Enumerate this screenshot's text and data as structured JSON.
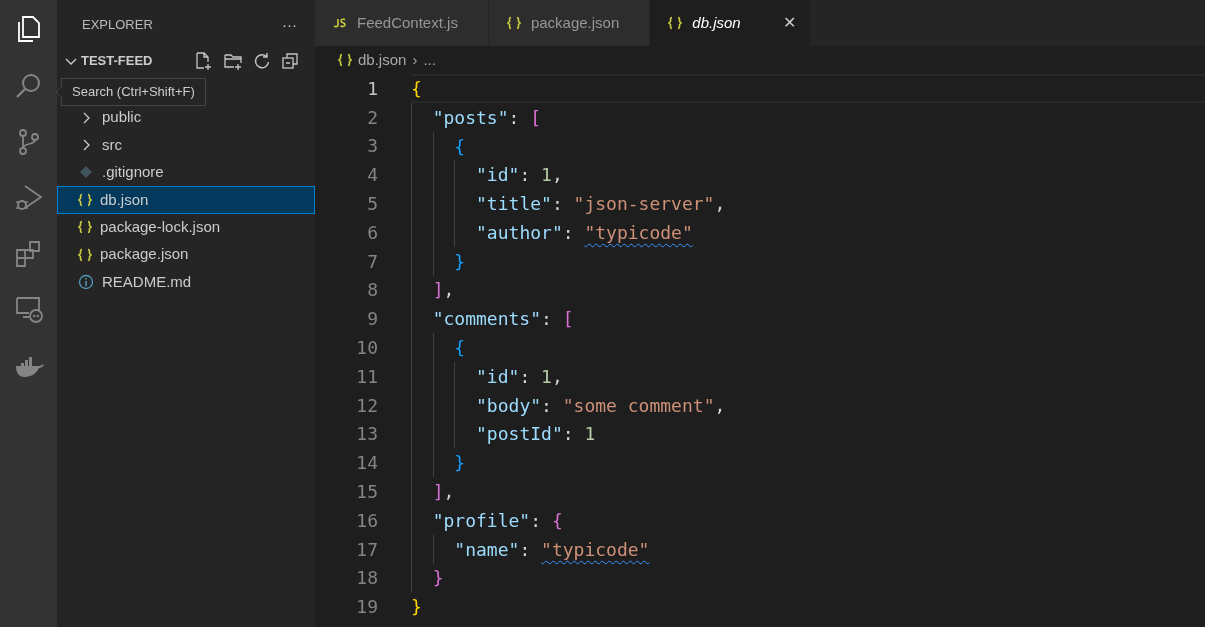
{
  "activity_bar": [
    {
      "kind": "files",
      "selected": true
    },
    {
      "kind": "search",
      "selected": false
    },
    {
      "kind": "git",
      "selected": false
    },
    {
      "kind": "debug",
      "selected": false
    },
    {
      "kind": "extensions",
      "selected": false
    },
    {
      "kind": "remote",
      "selected": false
    },
    {
      "kind": "docker",
      "selected": false
    }
  ],
  "tooltip": "Search (Ctrl+Shift+F)",
  "sidebar": {
    "title": "EXPLORER",
    "more": "···",
    "folder": {
      "name": "TEST-FEED",
      "expanded": true
    },
    "items": [
      {
        "kind": "folder",
        "name": "public",
        "expanded": false,
        "selected": false
      },
      {
        "kind": "folder",
        "name": "src",
        "expanded": false,
        "selected": false
      },
      {
        "kind": "git",
        "name": ".gitignore",
        "selected": false
      },
      {
        "kind": "json",
        "name": "db.json",
        "selected": true
      },
      {
        "kind": "json",
        "name": "package-lock.json",
        "selected": false
      },
      {
        "kind": "json",
        "name": "package.json",
        "selected": false
      },
      {
        "kind": "info",
        "name": "README.md",
        "selected": false
      }
    ]
  },
  "tabs": [
    {
      "kind": "js",
      "label": "FeedContext.js",
      "selected": false
    },
    {
      "kind": "json",
      "label": "package.json",
      "selected": false
    },
    {
      "kind": "json",
      "label": "db.json",
      "selected": true,
      "close": "✕"
    }
  ],
  "breadcrumb": {
    "file": "db.json",
    "sep": "›",
    "rest": "..."
  },
  "lines": [
    {
      "number": "1",
      "current": true,
      "tokens": [
        {
          "kind": "open1",
          "text": "{"
        }
      ]
    },
    {
      "number": "2",
      "tokens": [
        {
          "kind": "key",
          "text": "\"posts\""
        },
        {
          "kind": "punct",
          "text": ": "
        },
        {
          "kind": "open2",
          "text": "["
        }
      ]
    },
    {
      "number": "3",
      "tokens": [
        {
          "kind": "open3",
          "text": "{"
        }
      ]
    },
    {
      "number": "4",
      "tokens": [
        {
          "kind": "key",
          "text": "\"id\""
        },
        {
          "kind": "punct",
          "text": ": "
        },
        {
          "kind": "number",
          "text": "1"
        },
        {
          "kind": "punct",
          "text": ","
        }
      ]
    },
    {
      "number": "5",
      "tokens": [
        {
          "kind": "key",
          "text": "\"title\""
        },
        {
          "kind": "punct",
          "text": ": "
        },
        {
          "kind": "string",
          "text": "\"json-server\""
        },
        {
          "kind": "punct",
          "text": ","
        }
      ]
    },
    {
      "number": "6",
      "tokens": [
        {
          "kind": "key",
          "text": "\"author\""
        },
        {
          "kind": "punct",
          "text": ": "
        },
        {
          "kind": "string",
          "text": "\"typicode\"",
          "squiggle": true
        }
      ]
    },
    {
      "number": "7",
      "tokens": [
        {
          "kind": "close3",
          "text": "}"
        }
      ]
    },
    {
      "number": "8",
      "tokens": [
        {
          "kind": "close2",
          "text": "]"
        },
        {
          "kind": "punct",
          "text": ","
        }
      ]
    },
    {
      "number": "9",
      "tokens": [
        {
          "kind": "key",
          "text": "\"comments\""
        },
        {
          "kind": "punct",
          "text": ": "
        },
        {
          "kind": "open2",
          "text": "["
        }
      ]
    },
    {
      "number": "10",
      "tokens": [
        {
          "kind": "open3",
          "text": "{"
        }
      ]
    },
    {
      "number": "11",
      "tokens": [
        {
          "kind": "key",
          "text": "\"id\""
        },
        {
          "kind": "punct",
          "text": ": "
        },
        {
          "kind": "number",
          "text": "1"
        },
        {
          "kind": "punct",
          "text": ","
        }
      ]
    },
    {
      "number": "12",
      "tokens": [
        {
          "kind": "key",
          "text": "\"body\""
        },
        {
          "kind": "punct",
          "text": ": "
        },
        {
          "kind": "string",
          "text": "\"some comment\""
        },
        {
          "kind": "punct",
          "text": ","
        }
      ]
    },
    {
      "number": "13",
      "tokens": [
        {
          "kind": "key",
          "text": "\"postId\""
        },
        {
          "kind": "punct",
          "text": ": "
        },
        {
          "kind": "number",
          "text": "1"
        }
      ]
    },
    {
      "number": "14",
      "tokens": [
        {
          "kind": "close3",
          "text": "}"
        }
      ]
    },
    {
      "number": "15",
      "tokens": [
        {
          "kind": "close2",
          "text": "]"
        },
        {
          "kind": "punct",
          "text": ","
        }
      ]
    },
    {
      "number": "16",
      "tokens": [
        {
          "kind": "key",
          "text": "\"profile\""
        },
        {
          "kind": "punct",
          "text": ": "
        },
        {
          "kind": "open2",
          "text": "{"
        }
      ]
    },
    {
      "number": "17",
      "tokens": [
        {
          "kind": "key",
          "text": "\"name\""
        },
        {
          "kind": "punct",
          "text": ": "
        },
        {
          "kind": "string",
          "text": "\"typicode\"",
          "squiggle": true
        }
      ]
    },
    {
      "number": "18",
      "tokens": [
        {
          "kind": "close2",
          "text": "}"
        }
      ]
    },
    {
      "number": "19",
      "tokens": [
        {
          "kind": "close1",
          "text": "}"
        }
      ]
    }
  ]
}
